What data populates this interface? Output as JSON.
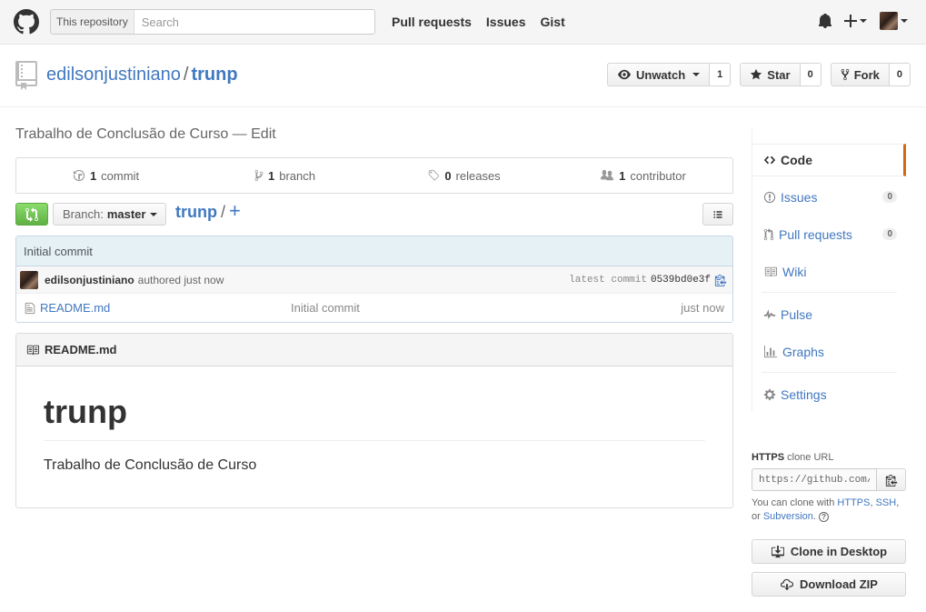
{
  "header": {
    "search_scope": "This repository",
    "search_placeholder": "Search",
    "nav": [
      "Pull requests",
      "Issues",
      "Gist"
    ]
  },
  "repo": {
    "owner": "edilsonjustiniano",
    "separator": "/",
    "name": "trunp",
    "watch_label": "Unwatch",
    "watch_count": "1",
    "star_label": "Star",
    "star_count": "0",
    "fork_label": "Fork",
    "fork_count": "0"
  },
  "description": {
    "text": "Trabalho de Conclusão de Curso",
    "dash": "—",
    "edit": "Edit"
  },
  "summary": {
    "commits_num": "1",
    "commits_label": "commit",
    "branches_num": "1",
    "branches_label": "branch",
    "releases_num": "0",
    "releases_label": "releases",
    "contributors_num": "1",
    "contributors_label": "contributor"
  },
  "filebar": {
    "branch_label": "Branch:",
    "branch_name": "master",
    "path_repo": "trunp",
    "path_sep": "/",
    "add": "+"
  },
  "commit": {
    "title": "Initial commit",
    "author": "edilsonjustiniano",
    "authored": "authored just now",
    "latest_label": "latest commit",
    "sha": "0539bd0e3f"
  },
  "files": [
    {
      "name": "README.md",
      "message": "Initial commit",
      "age": "just now"
    }
  ],
  "readme": {
    "filename": "README.md",
    "heading": "trunp",
    "body": "Trabalho de Conclusão de Curso"
  },
  "sidebar": {
    "items": [
      {
        "label": "Code",
        "icon": "code-icon"
      },
      {
        "label": "Issues",
        "count": "0",
        "icon": "issue-icon"
      },
      {
        "label": "Pull requests",
        "count": "0",
        "icon": "pull-request-icon"
      },
      {
        "label": "Wiki",
        "icon": "book-icon"
      },
      {
        "label": "Pulse",
        "icon": "pulse-icon"
      },
      {
        "label": "Graphs",
        "icon": "graph-icon"
      },
      {
        "label": "Settings",
        "icon": "gear-icon"
      }
    ]
  },
  "clone": {
    "protocol": "HTTPS",
    "title_rest": "clone URL",
    "url": "https://github.com/edilsonjustiniano/trunp.git",
    "help_prefix": "You can clone with",
    "https": "HTTPS",
    "ssh": "SSH",
    "or": "or",
    "svn": "Subversion",
    "help_q": "?",
    "desktop": "Clone in Desktop",
    "zip": "Download ZIP"
  },
  "colors": {
    "link": "#4078c0",
    "selected_accent": "#d26911",
    "compare_green": "#60b044"
  }
}
